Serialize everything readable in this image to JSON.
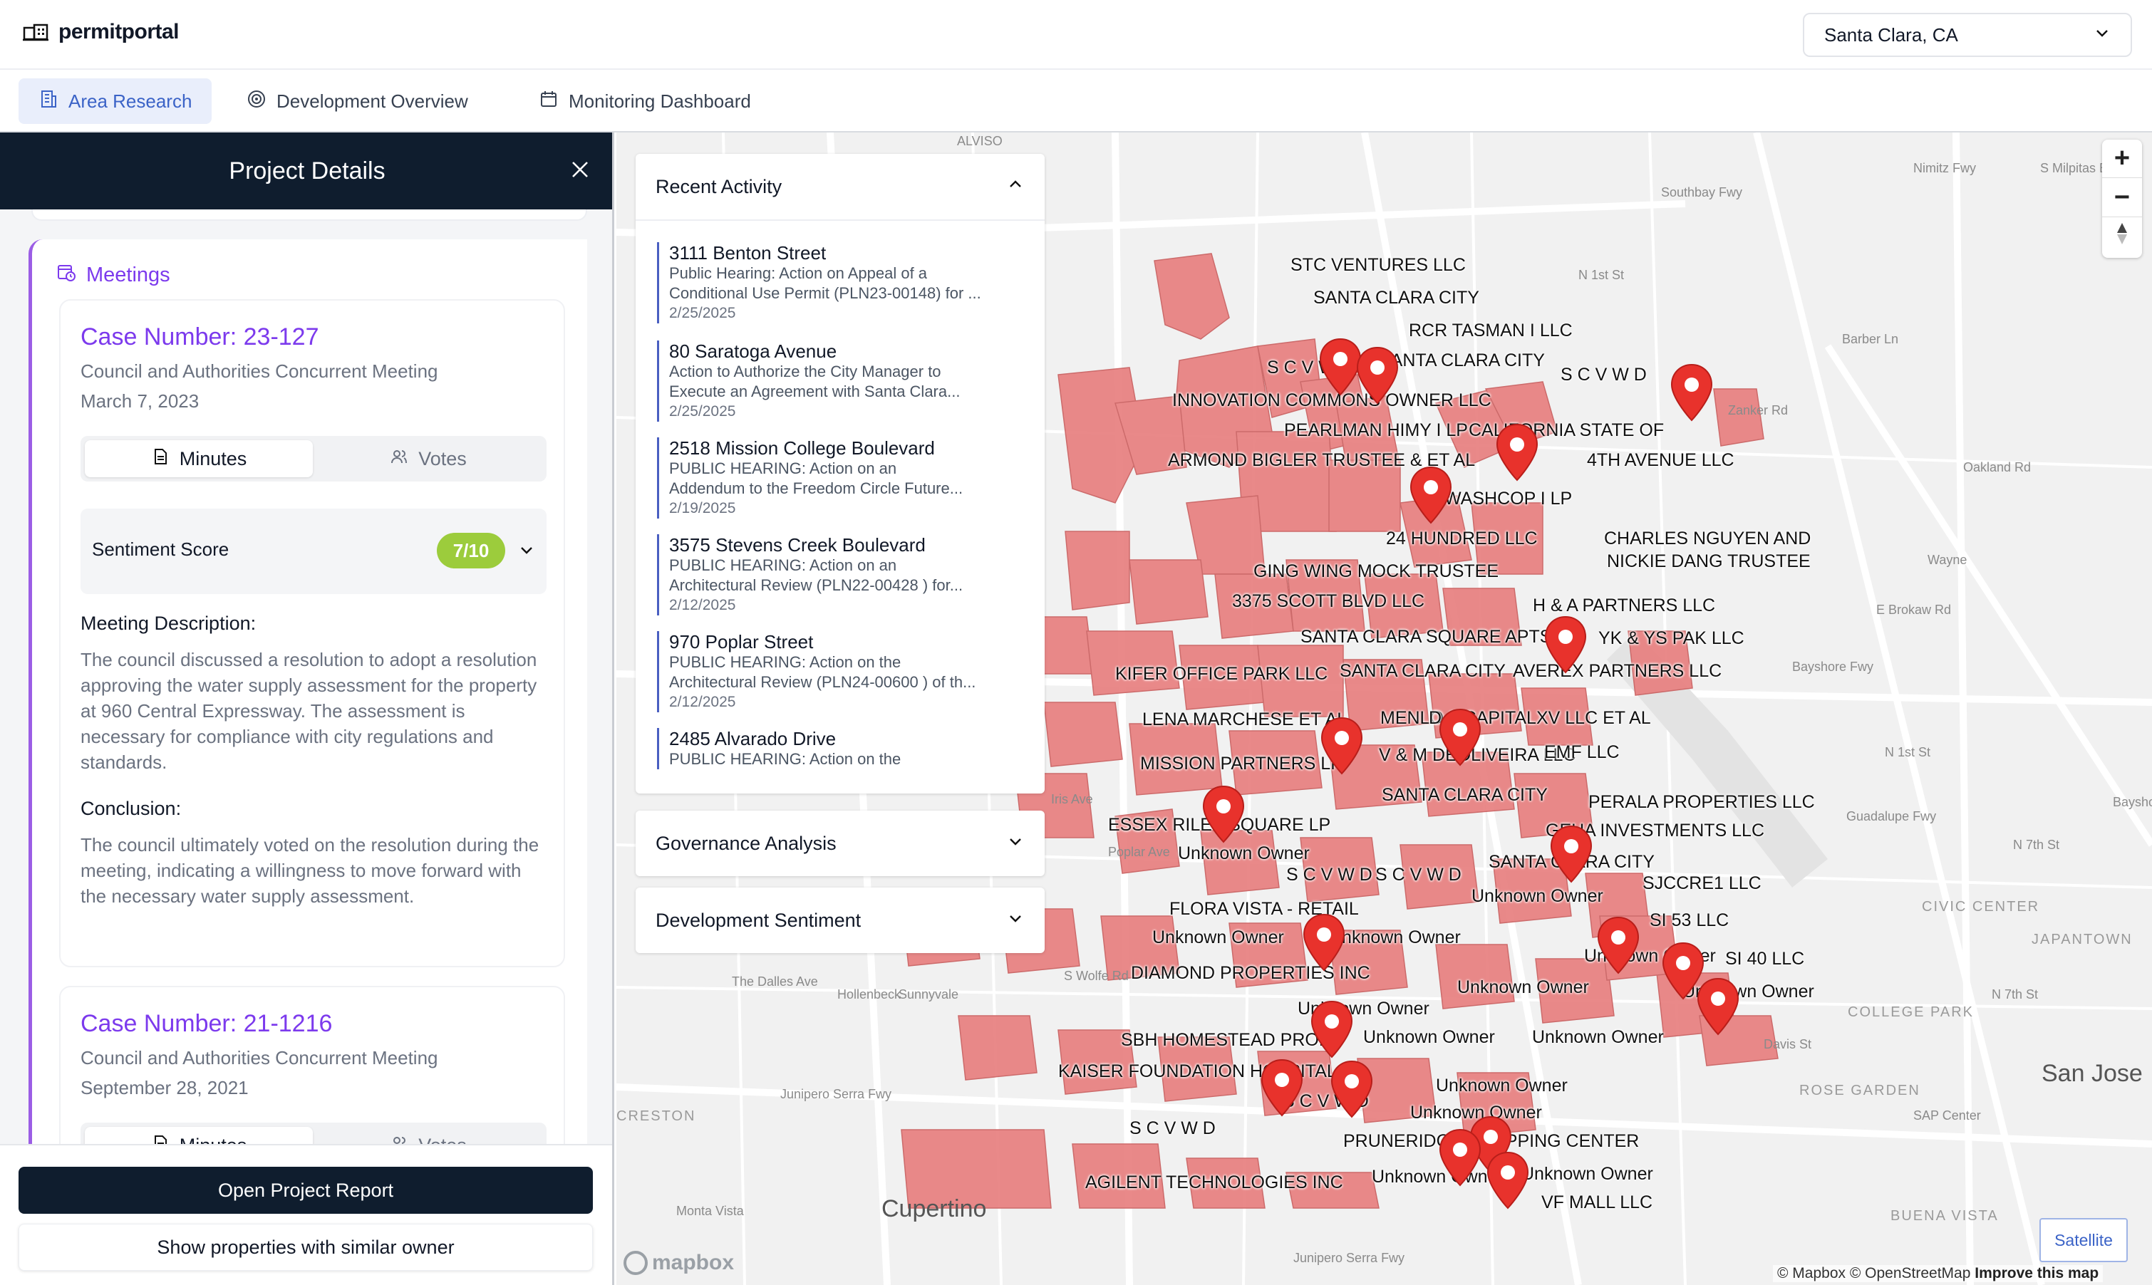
{
  "app": {
    "name": "permitportal",
    "location": "Santa Clara, CA"
  },
  "nav": {
    "tabs": [
      {
        "label": "Area Research",
        "icon": "building-icon",
        "active": true
      },
      {
        "label": "Development Overview",
        "icon": "target-icon",
        "active": false
      },
      {
        "label": "Monitoring Dashboard",
        "icon": "calendar-icon",
        "active": false
      }
    ]
  },
  "panel": {
    "title": "Project Details",
    "meetings_title": "Meetings",
    "cases": [
      {
        "case_number": "Case Number: 23-127",
        "meeting_type": "Council and Authorities Concurrent Meeting",
        "date": "March 7, 2023",
        "minutes_label": "Minutes",
        "votes_label": "Votes",
        "sentiment_label": "Sentiment Score",
        "sentiment_score": "7/10",
        "description_heading": "Meeting Description:",
        "description": "The council discussed a resolution to adopt a resolution approving the water supply assessment for the property at 960 Central Expressway. The assessment is necessary for compliance with city regulations and standards.",
        "conclusion_heading": "Conclusion:",
        "conclusion": "The council ultimately voted on the resolution during the meeting, indicating a willingness to move forward with the necessary water supply assessment."
      },
      {
        "case_number": "Case Number: 21-1216",
        "meeting_type": "Council and Authorities Concurrent Meeting",
        "date": "September 28, 2021",
        "minutes_label": "Minutes",
        "votes_label": "Votes"
      }
    ],
    "open_report_label": "Open Project Report",
    "similar_owner_label": "Show properties with similar owner"
  },
  "recent_activity": {
    "title": "Recent Activity",
    "items": [
      {
        "title": "3111 Benton Street",
        "desc1": "Public Hearing: Action on Appeal of a",
        "desc2": "Conditional Use Permit (PLN23-00148) for ...",
        "date": "2/25/2025"
      },
      {
        "title": "80 Saratoga Avenue",
        "desc1": "Action to Authorize the City Manager to",
        "desc2": "Execute an Agreement with Santa Clara...",
        "date": "2/25/2025"
      },
      {
        "title": "2518 Mission College Boulevard",
        "desc1": "PUBLIC HEARING: Action on an",
        "desc2": "Addendum to the Freedom Circle Future...",
        "date": "2/19/2025"
      },
      {
        "title": "3575 Stevens Creek Boulevard",
        "desc1": "PUBLIC HEARING: Action on an",
        "desc2": "Architectural Review (PLN22-00428 ) for...",
        "date": "2/12/2025"
      },
      {
        "title": "970 Poplar Street",
        "desc1": "PUBLIC HEARING: Action on the",
        "desc2": "Architectural Review (PLN24-00600 ) of th...",
        "date": "2/12/2025"
      },
      {
        "title": "2485 Alvarado Drive",
        "desc1": "PUBLIC HEARING: Action on the",
        "desc2": "",
        "date": ""
      }
    ]
  },
  "accordions": {
    "governance": "Governance Analysis",
    "sentiment": "Development Sentiment"
  },
  "map": {
    "satellite_label": "Satellite",
    "attribution_text": "© Mapbox © OpenStreetMap",
    "improve_label": "Improve this map",
    "mapbox_label": "mapbox",
    "zoom_in": "+",
    "zoom_out": "−",
    "owner_labels": [
      "STC VENTURES LLC",
      "SANTA CLARA CITY",
      "RCR TASMAN I LLC",
      "S C V W D",
      "SANTA CLARA CITY",
      "S C V W D",
      "INNOVATION COMMONS OWNER LLC",
      "PEARLMAN HIMY I LP",
      "CALIFORNIA STATE OF",
      "ARMOND BIGLER TRUSTEE & ET AL",
      "4TH AVENUE LLC",
      "WASHCOP I LP",
      "24 HUNDRED LLC",
      "CHARLES NGUYEN AND",
      "NICKIE DANG TRUSTEE",
      "GING WING MOCK TRUSTEE",
      "3375 SCOTT BLVD LLC",
      "H & A PARTNERS LLC",
      "SANTA CLARA SQUARE APTS",
      "YK & YS PAK LLC",
      "KIFER OFFICE PARK LLC",
      "SANTA CLARA CITY",
      "AVEREX PARTNERS LLC",
      "LENA MARCHESE ET AL",
      "MENLO",
      "D & CAPITALXV LLC ET AL",
      "V & M DEOLIVEIRA LLC",
      "EMF LLC",
      "MISSION PARTNERS LP",
      "SANTA CLARA CITY",
      "PERALA PROPERTIES LLC",
      "ESSEX RILEY SQUARE LP",
      "GEHA INVESTMENTS LLC",
      "Unknown Owner",
      "SANTA CLARA CITY",
      "S C V W D",
      "S C V W D",
      "Unknown Owner",
      "SJCCRE1 LLC",
      "FLORA VISTA - RETAIL",
      "SI 53 LLC",
      "Unknown Owner",
      "Unknown Owner",
      "Unknown Owner",
      "SI 40 LLC",
      "DIAMOND PROPERTIES INC",
      "Unknown Owner",
      "Unknown Owner",
      "Unknown Owner",
      "SBH HOMESTEAD PROPS",
      "Unknown Owner",
      "Unknown Owner",
      "KAISER FOUNDATION HOSPITALS",
      "S C V W D",
      "Unknown Owner",
      "S C V W D",
      "Unknown Owner",
      "PRUNERIDGE SHOPPING CENTER",
      "AGILENT TECHNOLOGIES INC",
      "Unknown Owner",
      "Unknown Owner",
      "VF MALL LLC"
    ],
    "street_labels": [
      "ALVISO",
      "Southbay Fwy",
      "N 1st St",
      "Zanker Rd",
      "Barber Ln",
      "Oakland Rd",
      "Nimitz Fwy",
      "Wayne",
      "E Brokaw Rd",
      "Bayshore Fwy",
      "N 1st St",
      "Guadalupe Fwy",
      "N 7th St",
      "S Milpitas Blvd",
      "Iris Ave",
      "Poplar Ave",
      "The Dalles Ave",
      "S Wolfe Rd",
      "Junipero Serra Fwy",
      "Junipero Serra Fwy",
      "Monta Vista",
      "Davis St",
      "N 7th St",
      "Bayshore",
      "SAP Center",
      "Sunnyvale",
      "Hollenbeck",
      "Cupertino"
    ],
    "area_labels": [
      "CIVIC CENTER",
      "JAPANTOWN",
      "COLLEGE PARK",
      "ROSE GARDEN",
      "BUENA VISTA",
      "CRESTON"
    ],
    "city_labels": [
      "Cupertino",
      "San Jose"
    ]
  }
}
